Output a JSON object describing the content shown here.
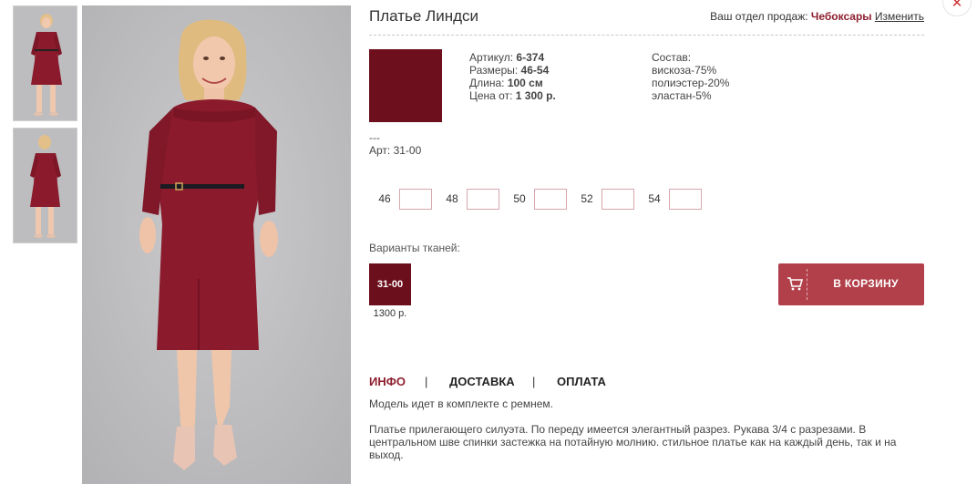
{
  "product": {
    "title": "Платье Линдси",
    "region_label": "Ваш отдел продаж:",
    "region_city": "Чебоксары",
    "region_change": "Изменить",
    "swatch_color": "#6d0f1d",
    "specs": {
      "article_label": "Артикул:",
      "article_value": "6-374",
      "sizes_label": "Размеры:",
      "sizes_value": "46-54",
      "length_label": "Длина:",
      "length_value": "100 см",
      "price_label": "Цена от:",
      "price_value": "1 300 р."
    },
    "composition": {
      "label": "Состав:",
      "items": [
        "вискоза-75%",
        "полиэстер-20%",
        "эластан-5%"
      ]
    },
    "dashes": "---",
    "art_code": "Арт: 31-00",
    "sizes": [
      "46",
      "48",
      "50",
      "52",
      "54"
    ],
    "variants_label": "Варианты тканей:",
    "variant": {
      "code": "31-00",
      "price": "1300 р.",
      "color": "#6b0f1c"
    },
    "cart_button": "В КОРЗИНУ",
    "tabs": [
      "ИНФО",
      "ДОСТАВКА",
      "ОПЛАТА"
    ],
    "tab_separator": "|",
    "info": {
      "p1": "Модель идет в комплекте с ремнем.",
      "p2": "Платье прилегающего силуэта. По переду имеется элегантный разрез. Рукава 3/4 с разрезами. В центральном шве спинки застежка на потайную молнию. стильное платье как на каждый день, так и на выход."
    }
  },
  "colors": {
    "accent": "#8e1f2f",
    "button": "#b2404a",
    "dress": "#8a1a2c"
  }
}
